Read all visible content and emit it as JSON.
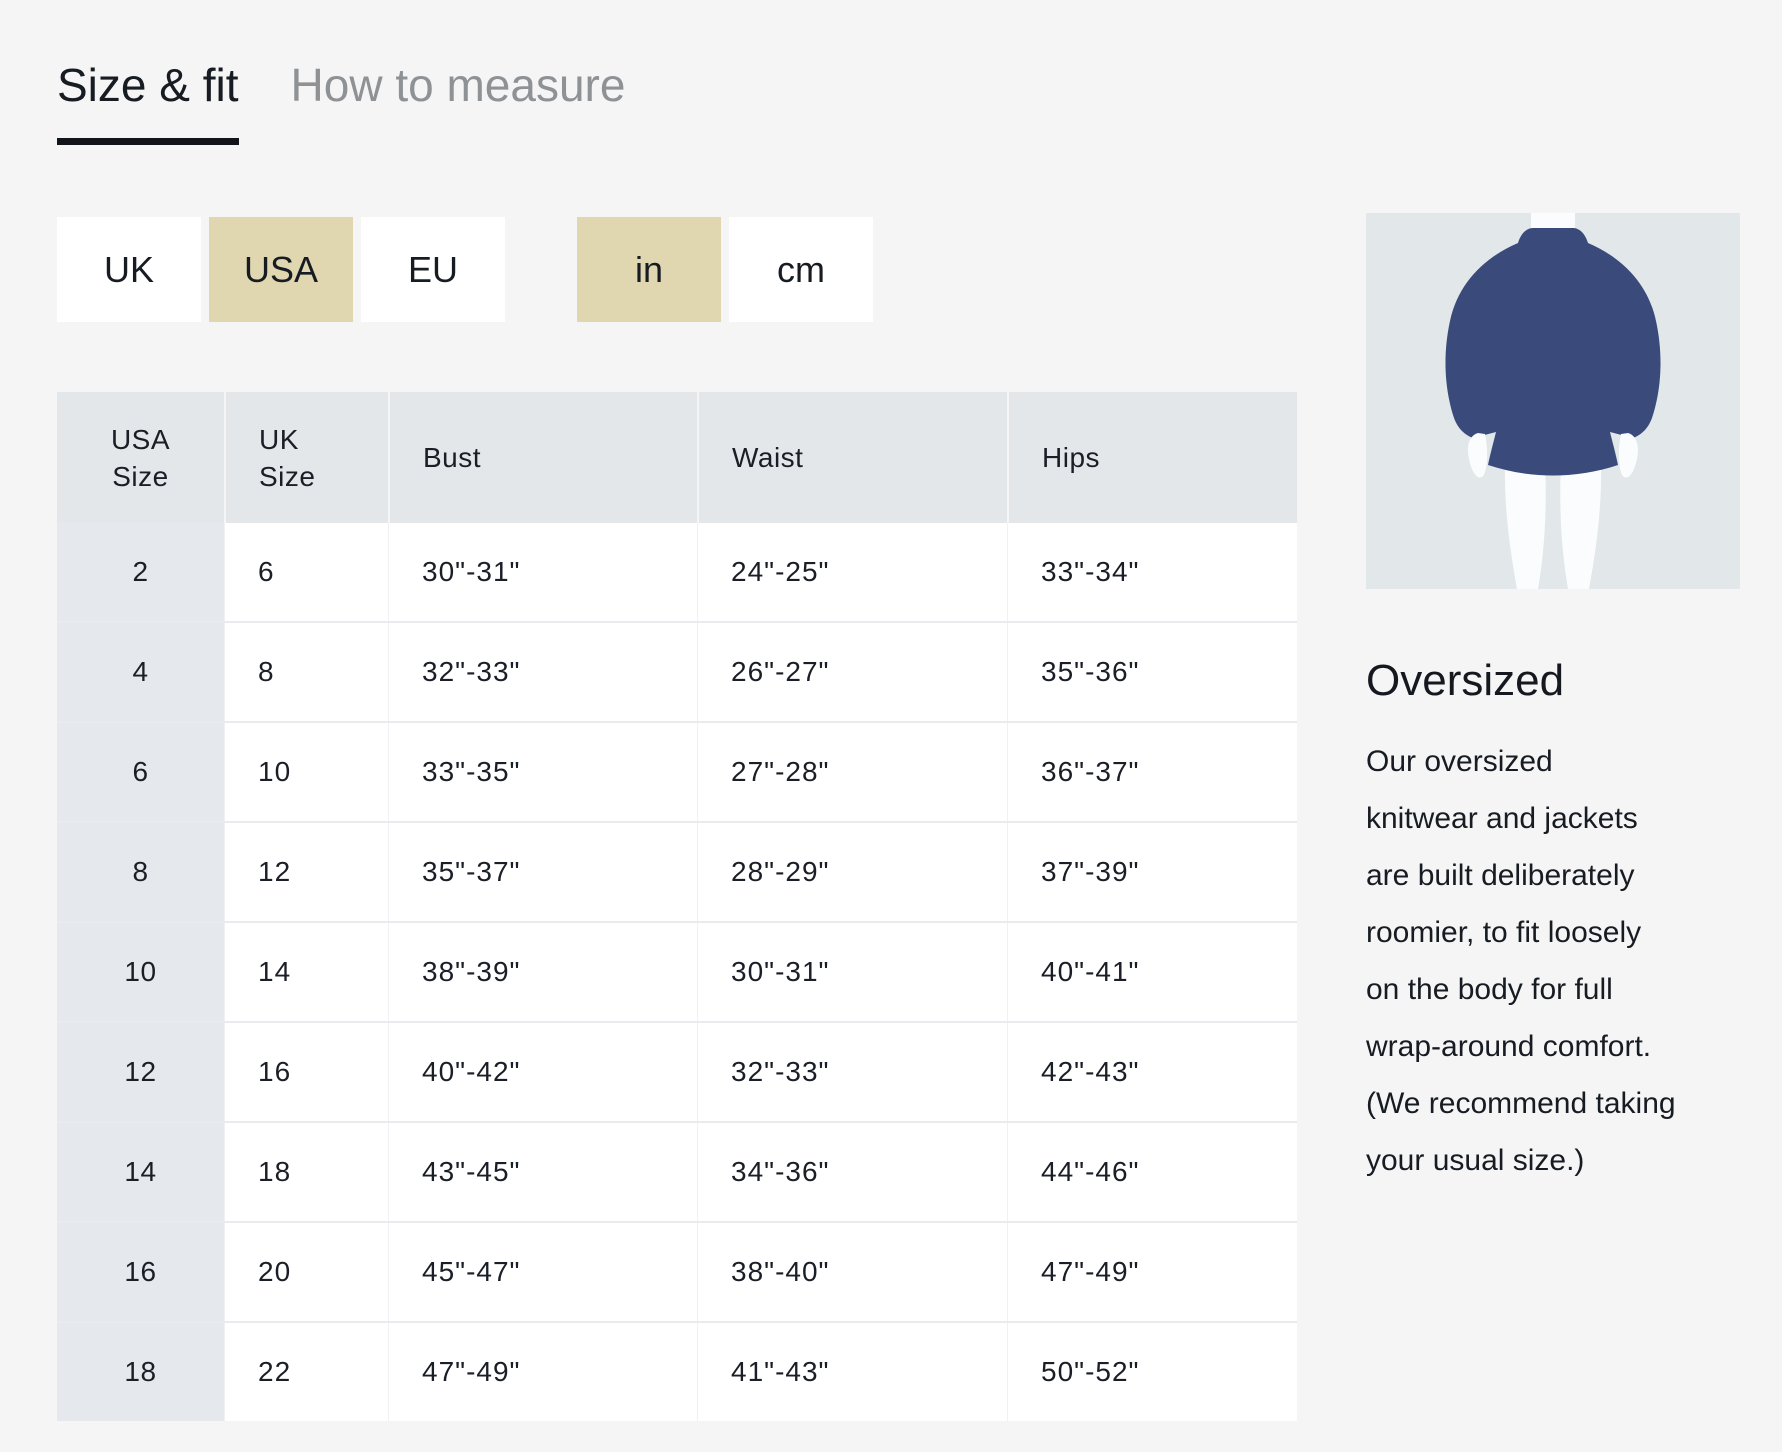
{
  "tabs": {
    "size_fit": "Size & fit",
    "how_to_measure": "How to measure"
  },
  "toggles": {
    "region": [
      {
        "label": "UK",
        "selected": false
      },
      {
        "label": "USA",
        "selected": true
      },
      {
        "label": "EU",
        "selected": false
      }
    ],
    "unit": [
      {
        "label": "in",
        "selected": true
      },
      {
        "label": "cm",
        "selected": false
      }
    ]
  },
  "table": {
    "headers": [
      "USA\nSize",
      "UK\nSize",
      "Bust",
      "Waist",
      "Hips"
    ],
    "rows": [
      [
        "2",
        "6",
        "30\"-31\"",
        "24\"-25\"",
        "33\"-34\""
      ],
      [
        "4",
        "8",
        "32\"-33\"",
        "26\"-27\"",
        "35\"-36\""
      ],
      [
        "6",
        "10",
        "33\"-35\"",
        "27\"-28\"",
        "36\"-37\""
      ],
      [
        "8",
        "12",
        "35\"-37\"",
        "28\"-29\"",
        "37\"-39\""
      ],
      [
        "10",
        "14",
        "38\"-39\"",
        "30\"-31\"",
        "40\"-41\""
      ],
      [
        "12",
        "16",
        "40\"-42\"",
        "32\"-33\"",
        "42\"-43\""
      ],
      [
        "14",
        "18",
        "43\"-45\"",
        "34\"-36\"",
        "44\"-46\""
      ],
      [
        "16",
        "20",
        "45\"-47\"",
        "38\"-40\"",
        "47\"-49\""
      ],
      [
        "18",
        "22",
        "47\"-49\"",
        "41\"-43\"",
        "50\"-52\""
      ]
    ]
  },
  "panel": {
    "illustration": "oversized-sweater-on-figure",
    "heading": "Oversized",
    "body": "Our oversized\nknitwear and jackets\nare built deliberately\nroomier, to fit loosely\non the body for full\nwrap-around comfort.\n(We recommend taking\nyour usual size.)"
  },
  "colors": {
    "page_background": "#f5f5f6",
    "selected_toggle": "#e0d7b1",
    "table_header": "#e4e7ea",
    "first_column": "#e5e8ec",
    "sweater_navy": "#3a4b7b",
    "illustration_background": "#e2e7ea",
    "active_tab_underline": "#11151a",
    "inactive_tab_text": "#8f9295"
  }
}
